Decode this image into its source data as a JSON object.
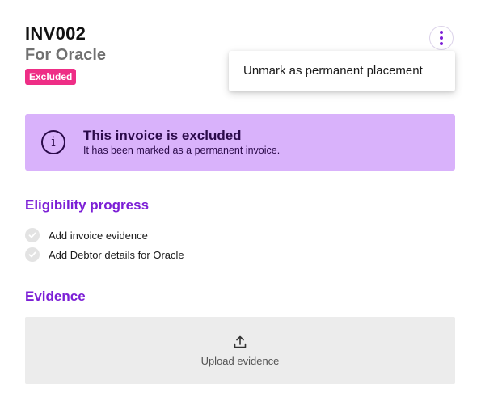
{
  "header": {
    "invoice_id": "INV002",
    "debtor": "For Oracle",
    "status_badge": "Excluded"
  },
  "menu": {
    "items": [
      {
        "label": "Unmark as permanent placement"
      }
    ]
  },
  "alert": {
    "title": "This invoice is excluded",
    "description": "It has been marked as a permanent invoice.",
    "icon": "info-icon"
  },
  "eligibility": {
    "title": "Eligibility progress",
    "items": [
      {
        "label": "Add invoice evidence",
        "icon": "check-icon"
      },
      {
        "label": "Add Debtor details for Oracle",
        "icon": "check-icon"
      }
    ]
  },
  "evidence": {
    "title": "Evidence",
    "upload_label": "Upload evidence",
    "icon": "upload-icon"
  },
  "colors": {
    "accent": "#7c1fd6",
    "badge": "#ee2e86",
    "alert_bg": "#d9b2fb",
    "upload_bg": "#ececec"
  }
}
